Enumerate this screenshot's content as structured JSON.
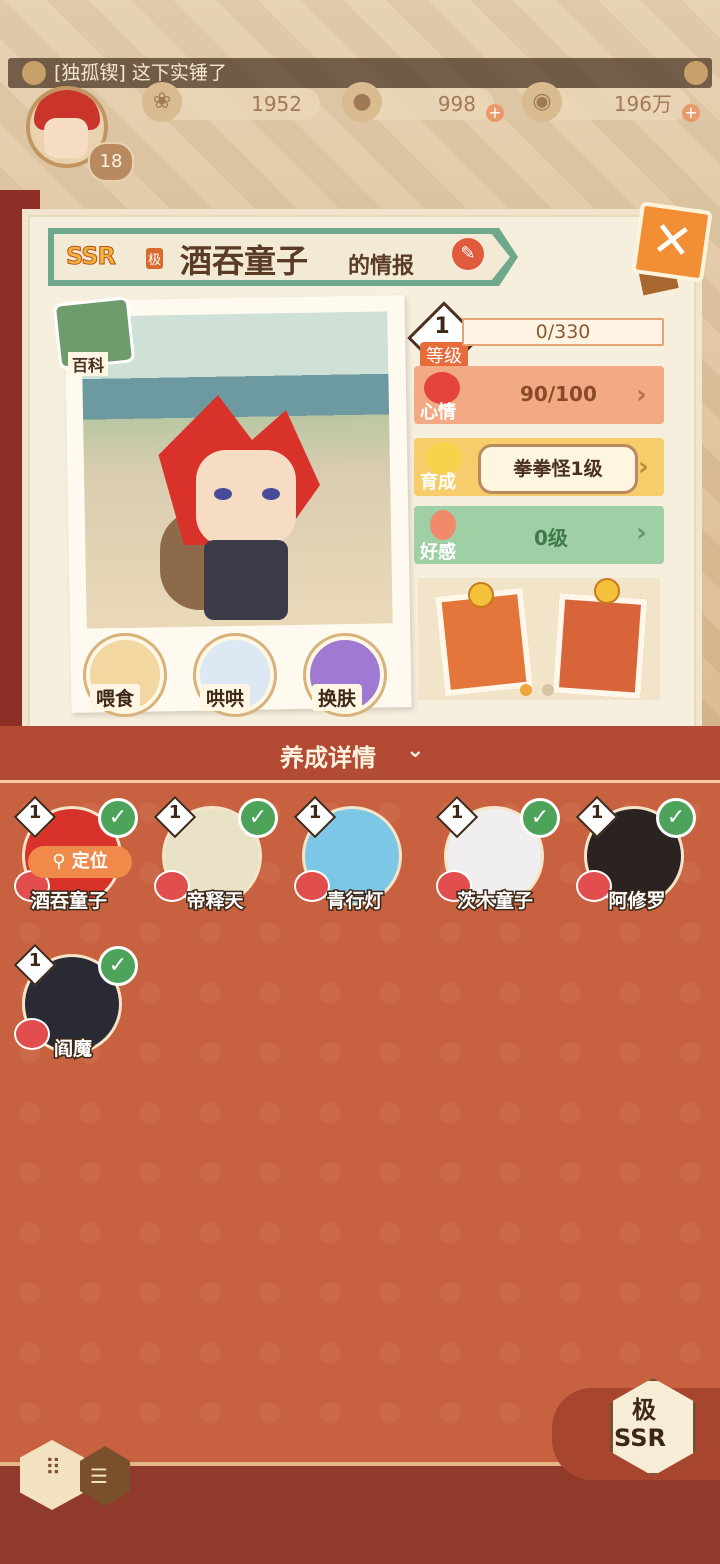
{
  "chat": {
    "message": "[独孤锲] 这下实锤了"
  },
  "player": {
    "level": "18"
  },
  "resources": [
    {
      "name": "jade",
      "value": "1952"
    },
    {
      "name": "gourd",
      "value": "998"
    },
    {
      "name": "coin",
      "value": "196万"
    }
  ],
  "info": {
    "rarity": "SSR",
    "rarity_sub": "极",
    "name": "酒吞童子",
    "suffix": "的情报",
    "baike_label": "百科",
    "actions": [
      "喂食",
      "哄哄",
      "换肤"
    ],
    "level_num": "1",
    "level_label": "等级",
    "xp": "0/330",
    "mood_label": "心情",
    "mood_value": "90/100",
    "grow_label": "育成",
    "grow_value": "拳拳怪1级",
    "fav_label": "好感",
    "fav_value": "0级"
  },
  "detail": {
    "title": "养成详情",
    "locate": "定位"
  },
  "heroes": [
    {
      "name": "酒吞童子",
      "level": "1",
      "color": "#d9322a"
    },
    {
      "name": "帝释天",
      "level": "1",
      "color": "#e9e2c6"
    },
    {
      "name": "青行灯",
      "level": "1",
      "color": "#7cc6e6"
    },
    {
      "name": "茨木童子",
      "level": "1",
      "color": "#f0eeee"
    },
    {
      "name": "阿修罗",
      "level": "1",
      "color": "#2b2222"
    },
    {
      "name": "阎魔",
      "level": "1",
      "color": "#2a2a34"
    }
  ],
  "filter": {
    "line1": "极",
    "line2": "SSR"
  },
  "colors": {
    "accent": "#c8613f",
    "mood": "#f3a983",
    "grow": "#f6cd6a",
    "fav": "#9fd0a5"
  }
}
